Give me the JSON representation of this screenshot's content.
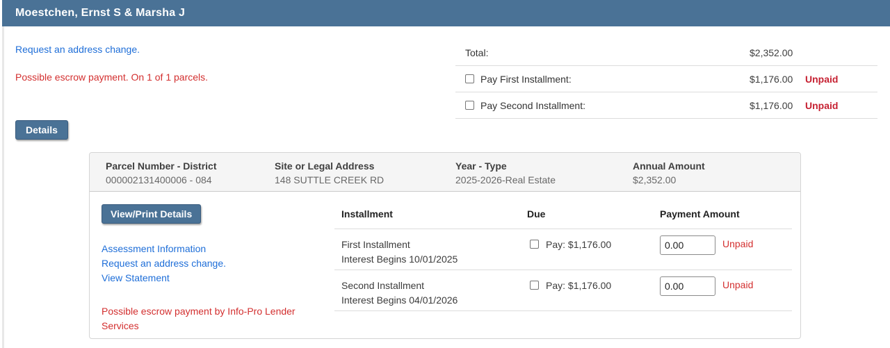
{
  "title_bar": {
    "title": "Moestchen, Ernst S & Marsha J"
  },
  "top": {
    "address_change_link": "Request an address change.",
    "escrow_note": "Possible escrow payment. On 1 of 1 parcels.",
    "details_button": "Details"
  },
  "summary": {
    "rows": [
      {
        "label": "Total:",
        "amount": "$2,352.00",
        "status": ""
      },
      {
        "label": "Pay First Installment:",
        "amount": "$1,176.00",
        "status": "Unpaid"
      },
      {
        "label": "Pay Second Installment:",
        "amount": "$1,176.00",
        "status": "Unpaid"
      }
    ]
  },
  "parcel": {
    "header": {
      "parcel_label": "Parcel Number - District",
      "parcel_value": "000002131400006 - 084",
      "address_label": "Site or Legal Address",
      "address_value": "148 SUTTLE CREEK RD",
      "year_label": "Year - Type",
      "year_value": "2025-2026-Real Estate",
      "amount_label": "Annual Amount",
      "amount_value": "$2,352.00"
    },
    "actions": {
      "view_print_button": "View/Print Details",
      "links": [
        "Assessment Information",
        "Request an address change.",
        "View Statement"
      ],
      "escrow_note": "Possible escrow payment by Info-Pro Lender Services"
    },
    "installments": {
      "headers": {
        "installment": "Installment",
        "due": "Due",
        "payment": "Payment Amount"
      },
      "rows": [
        {
          "name": "First Installment",
          "interest": "Interest Begins 10/01/2025",
          "due": "Pay: $1,176.00",
          "payment_value": "0.00",
          "status": "Unpaid"
        },
        {
          "name": "Second Installment",
          "interest": "Interest Begins 04/01/2026",
          "due": "Pay: $1,176.00",
          "payment_value": "0.00",
          "status": "Unpaid"
        }
      ]
    }
  },
  "colors": {
    "header_bar": "#4a7296",
    "link_blue": "#1e6ed8",
    "alert_red": "#d32f2f",
    "unpaid_red": "#c62132",
    "panel_header_bg": "#f5f5f5"
  }
}
